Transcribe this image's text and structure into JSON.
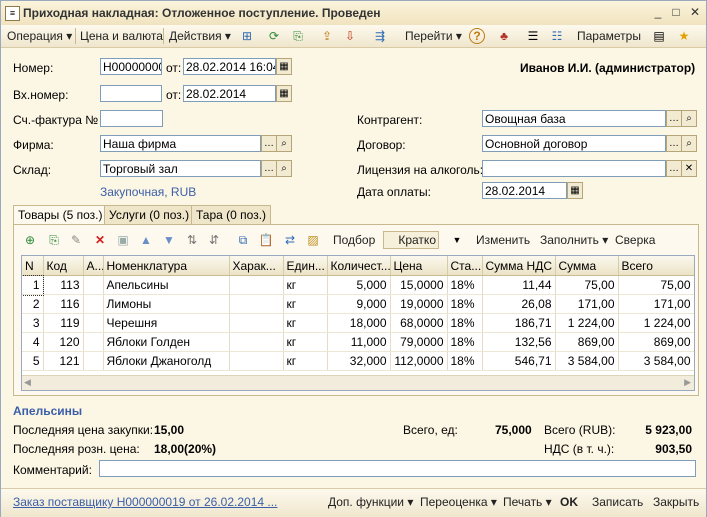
{
  "window": {
    "title": "Приходная накладная: Отложенное поступление. Проведен",
    "min": "_",
    "max": "□",
    "close": "✕"
  },
  "toolbar": {
    "operation": "Операция ▾",
    "price_currency": "Цена и валюта",
    "actions": "Действия ▾",
    "goto": "Перейти ▾",
    "help": "?",
    "params": "Параметры"
  },
  "header": {
    "number_label": "Номер:",
    "number_value": "Н000000000",
    "from_label": "от:",
    "date_value": "28.02.2014 16:04:",
    "in_number_label": "Вх.номер:",
    "in_number_value": "",
    "in_from_label": "от:",
    "in_date_value": "28.02.2014",
    "invoice_label": "Сч.-фактура №",
    "invoice_value": "",
    "firm_label": "Фирма:",
    "firm_value": "Наша фирма",
    "warehouse_label": "Склад:",
    "warehouse_value": "Торговый зал",
    "price_type_link": "Закупочная, RUB",
    "user": "Иванов И.И. (администратор)",
    "contractor_label": "Контрагент:",
    "contractor_value": "Овощная база",
    "contract_label": "Договор:",
    "contract_value": "Основной договор",
    "license_label": "Лицензия на алкоголь:",
    "license_value": "",
    "pay_date_label": "Дата оплаты:",
    "pay_date_value": "28.02.2014"
  },
  "tabs": [
    {
      "label": "Товары (5 поз.)"
    },
    {
      "label": "Услуги (0 поз.)"
    },
    {
      "label": "Тара (0 поз.)"
    }
  ],
  "grid_toolbar": {
    "select": "Подбор",
    "brief": "Кратко",
    "change": "Изменить",
    "fill": "Заполнить ▾",
    "reconcile": "Сверка"
  },
  "table": {
    "columns": [
      "N",
      "Код",
      "А...",
      "Номенклатура",
      "Харак...",
      "Един...",
      "Количест...",
      "Цена",
      "Ста...",
      "Сумма НДС",
      "Сумма",
      "Всего"
    ],
    "rows": [
      [
        "1",
        "113",
        "",
        "Апельсины",
        "",
        "кг",
        "5,000",
        "15,0000",
        "18%",
        "11,44",
        "75,00",
        "75,00"
      ],
      [
        "2",
        "116",
        "",
        "Лимоны",
        "",
        "кг",
        "9,000",
        "19,0000",
        "18%",
        "26,08",
        "171,00",
        "171,00"
      ],
      [
        "3",
        "119",
        "",
        "Черешня",
        "",
        "кг",
        "18,000",
        "68,0000",
        "18%",
        "186,71",
        "1 224,00",
        "1 224,00"
      ],
      [
        "4",
        "120",
        "",
        "Яблоки Голден",
        "",
        "кг",
        "11,000",
        "79,0000",
        "18%",
        "132,56",
        "869,00",
        "869,00"
      ],
      [
        "5",
        "121",
        "",
        "Яблоки Джаноголд",
        "",
        "кг",
        "32,000",
        "112,0000",
        "18%",
        "546,71",
        "3 584,00",
        "3 584,00"
      ]
    ]
  },
  "footer": {
    "current_item": "Апельсины",
    "last_purchase_label": "Последняя цена закупки:",
    "last_purchase_value": "15,00",
    "last_retail_label": "Последняя розн. цена:",
    "last_retail_value": "18,00(20%)",
    "total_units_label": "Всего, ед:",
    "total_units_value": "75,000",
    "total_rub_label": "Всего (RUB):",
    "total_rub_value": "5 923,00",
    "vat_label": "НДС (в т. ч.):",
    "vat_value": "903,50",
    "comment_label": "Комментарий:",
    "comment_value": ""
  },
  "bottom": {
    "order_link": "Заказ поставщику Н000000019 от 26.02.2014 ...",
    "extra": "Доп. функции ▾",
    "revalue": "Переоценка ▾",
    "print": "Печать ▾",
    "ok": "OK",
    "save": "Записать",
    "close": "Закрыть"
  }
}
